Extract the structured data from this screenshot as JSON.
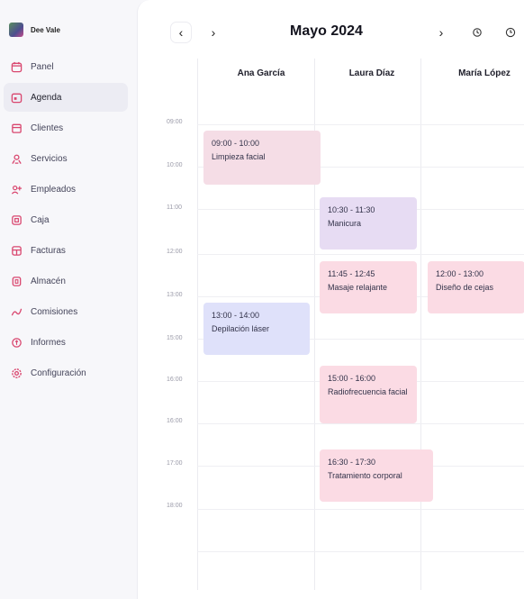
{
  "brand": {
    "name": "Dee Vale"
  },
  "sidebar": {
    "items": [
      {
        "label": "Panel",
        "icon": "calendar-icon",
        "active": false
      },
      {
        "label": "Agenda",
        "icon": "calendar-icon",
        "active": true
      },
      {
        "label": "Clientes",
        "icon": "clients-icon",
        "active": false
      },
      {
        "label": "Servicios",
        "icon": "services-icon",
        "active": false
      },
      {
        "label": "Empleados",
        "icon": "employees-icon",
        "active": false
      },
      {
        "label": "Caja",
        "icon": "cash-icon",
        "active": false
      },
      {
        "label": "Facturas",
        "icon": "invoice-icon",
        "active": false
      },
      {
        "label": "Almacén",
        "icon": "warehouse-icon",
        "active": false
      },
      {
        "label": "Comisiones",
        "icon": "commission-icon",
        "active": false
      },
      {
        "label": "Informes",
        "icon": "reports-icon",
        "active": false
      },
      {
        "label": "Configuración",
        "icon": "gear-icon",
        "active": false
      }
    ]
  },
  "header": {
    "prev_label": "‹",
    "next_label": "›",
    "month": "Mayo 2024",
    "next2_label": "›",
    "history_icon": "history-icon",
    "clock_icon": "clock-icon"
  },
  "columns": [
    "Ana García",
    "Laura Díaz",
    "María López"
  ],
  "times": [
    "09:00",
    "10:00",
    "11:00",
    "12:00",
    "13:00",
    "15:00",
    "16:00",
    "16:00",
    "17:00",
    "18:00"
  ],
  "events": [
    {
      "time": "09:00 - 10:00",
      "name": "Limpieza facial",
      "color": "#f5dde6"
    },
    {
      "time": "10:30 - 11:30",
      "name": "Manicura",
      "color": "#e7dcf3"
    },
    {
      "time": "11:45 - 12:45",
      "name": "Masaje relajante",
      "color": "#fbdbe4"
    },
    {
      "time": "12:00 - 13:00",
      "name": "Diseño de cejas",
      "color": "#fbdbe4"
    },
    {
      "time": "13:00 - 14:00",
      "name": "Depilación láser",
      "color": "#dfe1fa"
    },
    {
      "time": "15:00 - 16:00",
      "name": "Radiofrecuencia facial",
      "color": "#fbdbe4"
    },
    {
      "time": "16:30 - 17:30",
      "name": "Tratamiento corporal",
      "color": "#fbdbe4"
    }
  ],
  "colors": {
    "active_bg": "#ececf3",
    "accent_pink": "#fbdbe4"
  }
}
